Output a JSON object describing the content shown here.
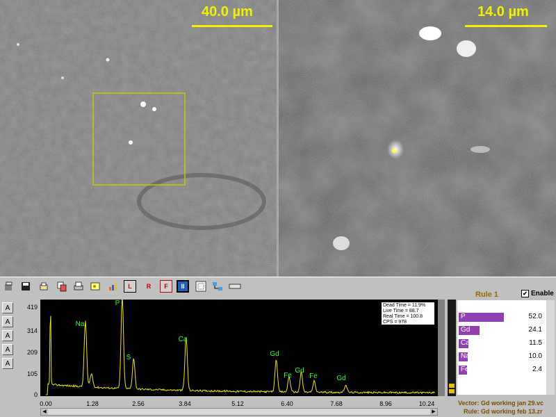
{
  "images": {
    "left_scale": "40.0 µm",
    "right_scale": "14.0 µm"
  },
  "toolbar": {
    "icons": [
      "open-icon",
      "save-icon",
      "print-preview-icon",
      "copy-icon",
      "print-icon",
      "image-icon",
      "chart-icon",
      "L",
      "R",
      "F",
      "pause-icon",
      "grid-icon",
      "network-icon",
      "ruler-icon"
    ]
  },
  "side_buttons": [
    "A",
    "A",
    "A",
    "A",
    "A"
  ],
  "spectrum": {
    "stats": [
      "Dead Time = 11.9%",
      "Live Time = 88.7",
      "Real Time = 100.8",
      "CPS = 978"
    ],
    "peak_labels": [
      "Na",
      "P",
      "S",
      "Ca",
      "Gd",
      "Fe",
      "Gd",
      "Fe",
      "Gd"
    ]
  },
  "chart_data": {
    "type": "line",
    "xlabel": "",
    "ylabel": "",
    "xlim": [
      0,
      10.24
    ],
    "ylim": [
      0,
      419
    ],
    "x_ticks": [
      "0.00",
      "1.28",
      "2.56",
      "3.84",
      "5.12",
      "6.40",
      "7.68",
      "8.96",
      "10.24"
    ],
    "y_ticks": [
      "419",
      "314",
      "209",
      "105",
      "0"
    ],
    "peaks": [
      {
        "label": "Na",
        "x": 1.04,
        "y": 300
      },
      {
        "label": "P",
        "x": 2.01,
        "y": 419
      },
      {
        "label": "S",
        "x": 2.31,
        "y": 140
      },
      {
        "label": "Ca",
        "x": 3.69,
        "y": 245
      },
      {
        "label": "Gd",
        "x": 6.06,
        "y": 150
      },
      {
        "label": "Fe",
        "x": 6.4,
        "y": 70
      },
      {
        "label": "Gd",
        "x": 6.72,
        "y": 90
      },
      {
        "label": "Fe",
        "x": 7.06,
        "y": 50
      },
      {
        "label": "Gd",
        "x": 7.89,
        "y": 35
      }
    ]
  },
  "rule": {
    "title": "Rule 1",
    "enable_label": "Enable",
    "enabled": "✔",
    "elements": [
      {
        "symbol": "P",
        "value": "52.0",
        "fraction": 0.52
      },
      {
        "symbol": "Gd",
        "value": "24.1",
        "fraction": 0.241
      },
      {
        "symbol": "Ca",
        "value": "11.5",
        "fraction": 0.115
      },
      {
        "symbol": "Na",
        "value": "10.0",
        "fraction": 0.1
      },
      {
        "symbol": "Fe",
        "value": "2.4",
        "fraction": 0.024
      }
    ],
    "vector_label": "Vector:",
    "vector_value": "Gd working jan 29.vc",
    "rule_label": "Rule:",
    "rule_value": "Gd working feb 13.zr"
  },
  "colors": {
    "scale": "#f2f200",
    "spectrum_line": "#e8e800",
    "peak_label": "#33ff33",
    "bar": "#9040b0"
  }
}
